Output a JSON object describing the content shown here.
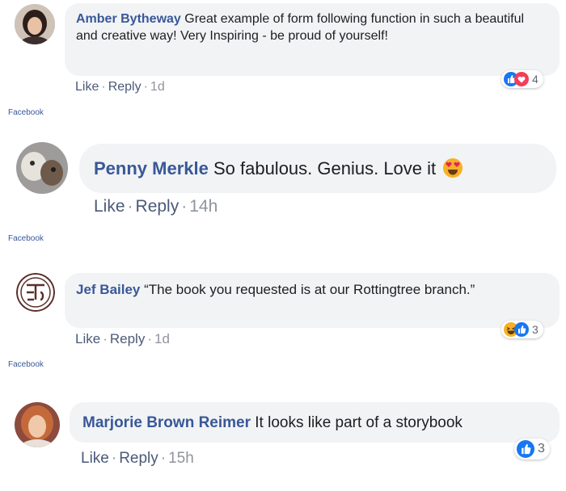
{
  "comments": [
    {
      "author": "Amber Bytheway",
      "text": "Great example of form following function in such a beautiful and creative way! Very Inspiring - be proud of yourself!",
      "like": "Like",
      "reply": "Reply",
      "time": "1d",
      "reaction_icons": [
        "like-icon",
        "love-icon"
      ],
      "reaction_count": "4",
      "source": "Facebook"
    },
    {
      "author": "Penny Merkle",
      "text": "So fabulous. Genius. Love it",
      "emoji": "heart-eyes-emoji",
      "like": "Like",
      "reply": "Reply",
      "time": "14h",
      "source": "Facebook"
    },
    {
      "author": "Jef Bailey",
      "text": "“The book you requested is at our Rottingtree branch.”",
      "like": "Like",
      "reply": "Reply",
      "time": "1d",
      "reaction_icons": [
        "haha-icon",
        "like-icon"
      ],
      "reaction_count": "3",
      "source": "Facebook"
    },
    {
      "author": "Marjorie Brown Reimer",
      "text": "It looks like part of a storybook",
      "like": "Like",
      "reply": "Reply",
      "time": "15h",
      "reaction_icons": [
        "like-icon"
      ],
      "reaction_count": "3"
    }
  ],
  "colors": {
    "author": "#385898",
    "bubble": "#f2f3f5",
    "like_blue": "#1877f2",
    "love_red": "#f33e58",
    "haha_yellow": "#f7b125"
  },
  "sep": "·"
}
